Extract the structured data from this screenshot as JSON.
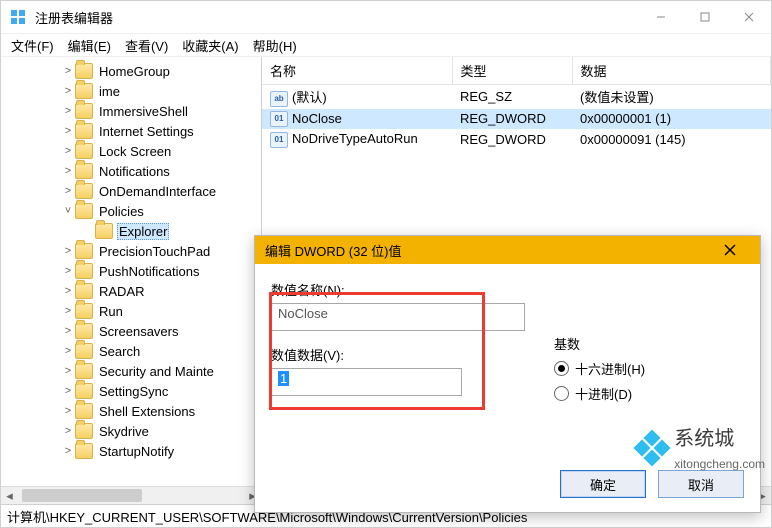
{
  "title": "注册表编辑器",
  "menus": [
    "文件(F)",
    "编辑(E)",
    "查看(V)",
    "收藏夹(A)",
    "帮助(H)"
  ],
  "tree": [
    {
      "label": "HomeGroup",
      "depth": 2,
      "twisty": ">"
    },
    {
      "label": "ime",
      "depth": 2,
      "twisty": ">"
    },
    {
      "label": "ImmersiveShell",
      "depth": 2,
      "twisty": ">"
    },
    {
      "label": "Internet Settings",
      "depth": 2,
      "twisty": ">"
    },
    {
      "label": "Lock Screen",
      "depth": 2,
      "twisty": ">"
    },
    {
      "label": "Notifications",
      "depth": 2,
      "twisty": ">"
    },
    {
      "label": "OnDemandInterface",
      "depth": 2,
      "twisty": ">"
    },
    {
      "label": "Policies",
      "depth": 2,
      "twisty": "v",
      "expanded": true
    },
    {
      "label": "Explorer",
      "depth": 3,
      "twisty": "",
      "selected": true
    },
    {
      "label": "PrecisionTouchPad",
      "depth": 2,
      "twisty": ">"
    },
    {
      "label": "PushNotifications",
      "depth": 2,
      "twisty": ">"
    },
    {
      "label": "RADAR",
      "depth": 2,
      "twisty": ">"
    },
    {
      "label": "Run",
      "depth": 2,
      "twisty": ">"
    },
    {
      "label": "Screensavers",
      "depth": 2,
      "twisty": ">"
    },
    {
      "label": "Search",
      "depth": 2,
      "twisty": ">"
    },
    {
      "label": "Security and Mainte",
      "depth": 2,
      "twisty": ">"
    },
    {
      "label": "SettingSync",
      "depth": 2,
      "twisty": ">"
    },
    {
      "label": "Shell Extensions",
      "depth": 2,
      "twisty": ">"
    },
    {
      "label": "Skydrive",
      "depth": 2,
      "twisty": ">"
    },
    {
      "label": "StartupNotify",
      "depth": 2,
      "twisty": ">"
    }
  ],
  "list": {
    "columns": [
      "名称",
      "类型",
      "数据"
    ],
    "rows": [
      {
        "icon": "str",
        "name": "(默认)",
        "type": "REG_SZ",
        "data": "(数值未设置)"
      },
      {
        "icon": "bin",
        "name": "NoClose",
        "type": "REG_DWORD",
        "data": "0x00000001 (1)",
        "selected": true
      },
      {
        "icon": "bin",
        "name": "NoDriveTypeAutoRun",
        "type": "REG_DWORD",
        "data": "0x00000091 (145)"
      }
    ]
  },
  "dialog": {
    "title": "编辑 DWORD (32 位)值",
    "name_label": "数值名称(N):",
    "name_value": "NoClose",
    "data_label": "数值数据(V):",
    "data_value": "1",
    "radix_label": "基数",
    "radix_hex": "十六进制(H)",
    "radix_dec": "十进制(D)",
    "ok": "确定",
    "cancel": "取消"
  },
  "statusbar": "计算机\\HKEY_CURRENT_USER\\SOFTWARE\\Microsoft\\Windows\\CurrentVersion\\Policies",
  "watermark": {
    "brand": "系统城",
    "site": "xitongcheng.com"
  }
}
